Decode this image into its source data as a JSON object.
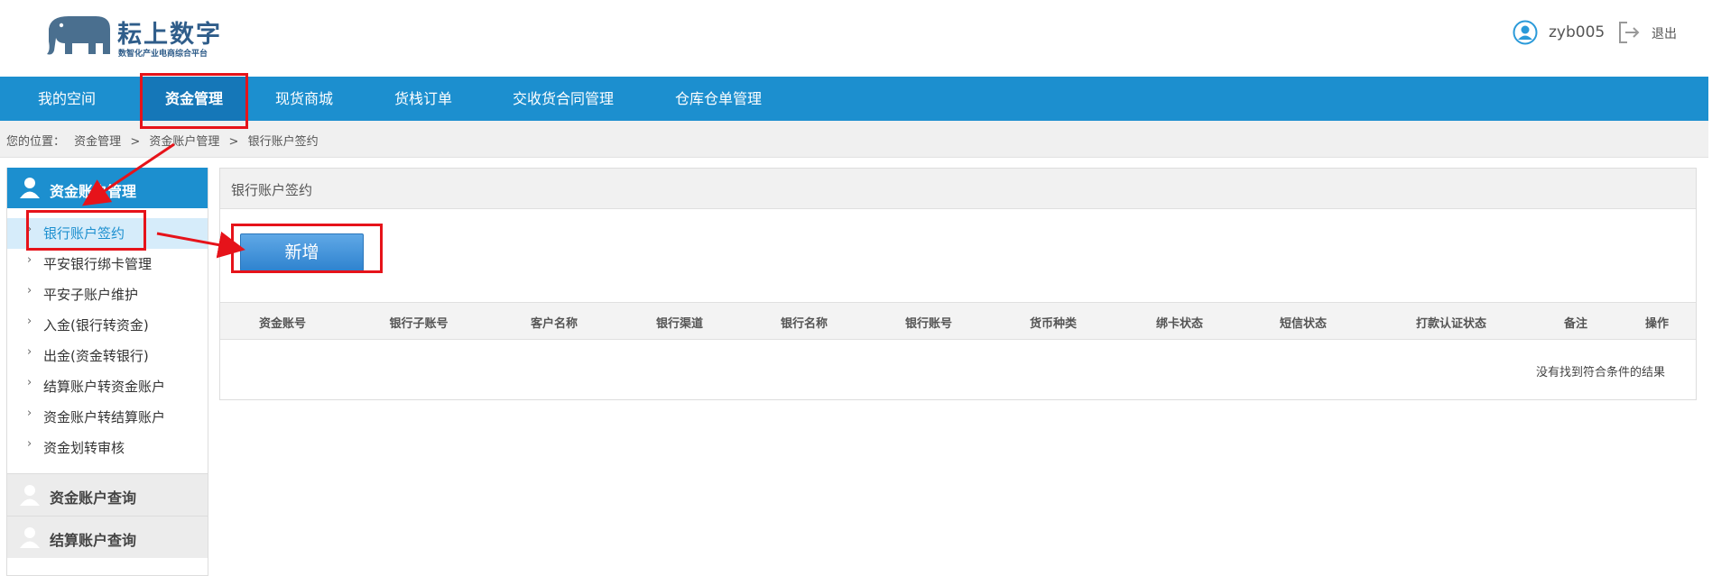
{
  "header": {
    "logo_title": "耘上数字",
    "logo_subtitle": "数智化产业电商综合平台",
    "username": "zyb005",
    "logout_label": "退出"
  },
  "nav": {
    "items": [
      {
        "label": "我的空间"
      },
      {
        "label": "资金管理",
        "active": true
      },
      {
        "label": "现货商城"
      },
      {
        "label": "货栈订单"
      },
      {
        "label": "交收货合同管理"
      },
      {
        "label": "仓库仓单管理"
      }
    ]
  },
  "breadcrumb": {
    "prefix": "您的位置：",
    "items": [
      "资金管理",
      "资金账户管理",
      "银行账户签约"
    ],
    "separator": ">"
  },
  "sidebar": {
    "header": "资金账户管理",
    "items": [
      {
        "label": "银行账户签约",
        "active": true
      },
      {
        "label": "平安银行绑卡管理"
      },
      {
        "label": "平安子账户维护"
      },
      {
        "label": "入金(银行转资金)"
      },
      {
        "label": "出金(资金转银行)"
      },
      {
        "label": "结算账户转资金账户"
      },
      {
        "label": "资金账户转结算账户"
      },
      {
        "label": "资金划转审核"
      }
    ],
    "groups": [
      {
        "label": "资金账户查询"
      },
      {
        "label": "结算账户查询"
      }
    ]
  },
  "main": {
    "panel_title": "银行账户签约",
    "add_button": "新增",
    "columns": [
      "资金账号",
      "银行子账号",
      "客户名称",
      "银行渠道",
      "银行名称",
      "银行账号",
      "货币种类",
      "绑卡状态",
      "短信状态",
      "打款认证状态",
      "备注",
      "操作"
    ],
    "empty_message": "没有找到符合条件的结果"
  },
  "colors": {
    "nav_bg": "#1c8fcf",
    "nav_active": "#1577b8",
    "annotation": "#e6131a",
    "button": "#2f83cf"
  }
}
